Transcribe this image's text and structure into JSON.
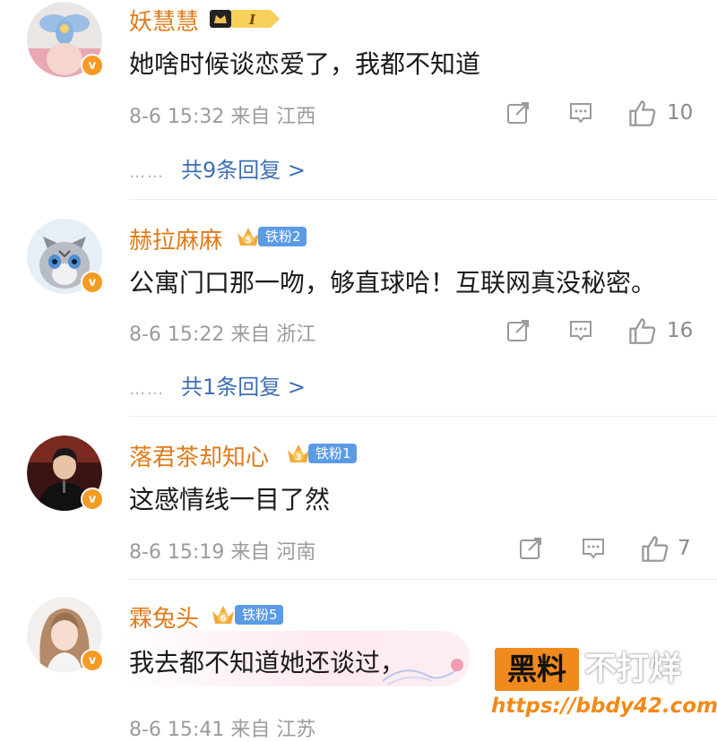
{
  "comments": [
    {
      "user": "妖慧慧",
      "text": "她啥时候谈恋爱了，我都不知道",
      "date": "8-6 15:32",
      "from": "来自",
      "location": "江西",
      "likes": "10",
      "replies": "共9条回复 >",
      "avatar_icon": "balloon-avatar"
    },
    {
      "user": "赫拉麻麻",
      "badge": "铁粉2",
      "crown_level": "5",
      "text": "公寓门口那一吻，够直球哈！互联网真没秘密。",
      "date": "8-6 15:22",
      "from": "来自",
      "location": "浙江",
      "likes": "16",
      "replies": "共1条回复 >",
      "avatar_icon": "kitten-avatar"
    },
    {
      "user": "落君茶却知心",
      "badge": "铁粉1",
      "crown_level": "3",
      "text": "这感情线一目了然",
      "date": "8-6 15:19",
      "from": "来自",
      "location": "河南",
      "likes": "7",
      "avatar_icon": "singer-avatar"
    },
    {
      "user": "霖兔头",
      "badge": "铁粉5",
      "crown_level": "6",
      "text": "我去都不知道她还谈过，",
      "date": "8-6 15:41",
      "from": "来自",
      "location": "江苏",
      "avatar_icon": "girl-avatar"
    }
  ],
  "medal_label": "I",
  "verified_mark": "v",
  "replies_dots": "……",
  "watermark": {
    "box": "黑料",
    "side": "不打烊",
    "url": "https://bbdy42.com"
  },
  "colors": {
    "username": "#e07b1a",
    "reply_link": "#3d6fb5",
    "fan_badge": "#5b9be6",
    "meta": "#9b9b9b",
    "verified": "#f59a23",
    "watermark": "#f08a1d"
  }
}
